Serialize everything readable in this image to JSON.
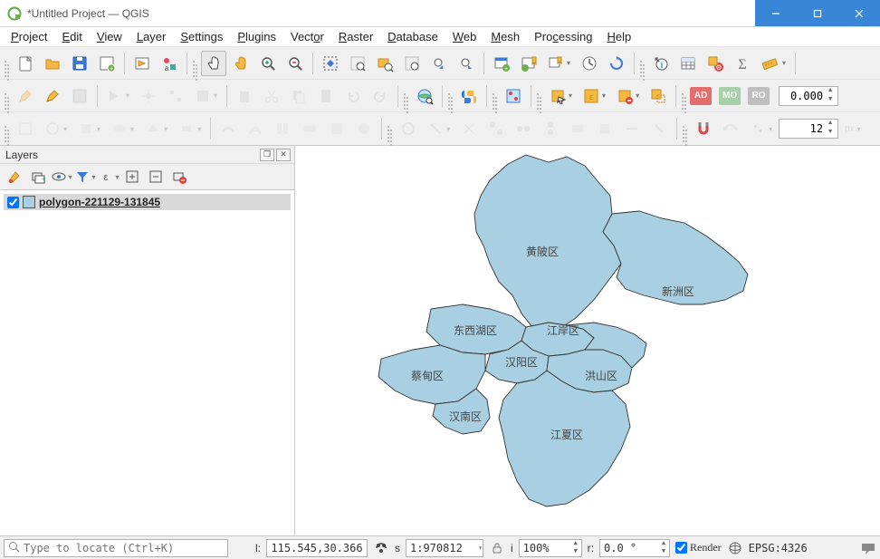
{
  "window": {
    "title": "*Untitled Project — QGIS"
  },
  "menu": [
    "Project",
    "Edit",
    "View",
    "Layer",
    "Settings",
    "Plugins",
    "Vector",
    "Raster",
    "Database",
    "Web",
    "Mesh",
    "Processing",
    "Help"
  ],
  "toolbars": {
    "row2": {
      "value1": "0.000"
    },
    "row3": {
      "snap_value": "12"
    }
  },
  "layers_panel": {
    "title": "Layers",
    "items": [
      {
        "checked": true,
        "name": "polygon-221129-131845"
      }
    ]
  },
  "map": {
    "regions": [
      "黄陂区",
      "新洲区",
      "东西湖区",
      "江岸区",
      "汉阳区",
      "蔡甸区",
      "洪山区",
      "汉南区",
      "江夏区"
    ]
  },
  "status": {
    "locator_placeholder": "Type to locate (Ctrl+K)",
    "coord_label": "l:",
    "coord": "115.545,30.366",
    "scale_label": "s",
    "scale": "1:970812",
    "mag_label": "i",
    "mag": "100%",
    "rot_label": "r:",
    "rot": "0.0 °",
    "render_label": "Render",
    "crs": "EPSG:4326"
  }
}
